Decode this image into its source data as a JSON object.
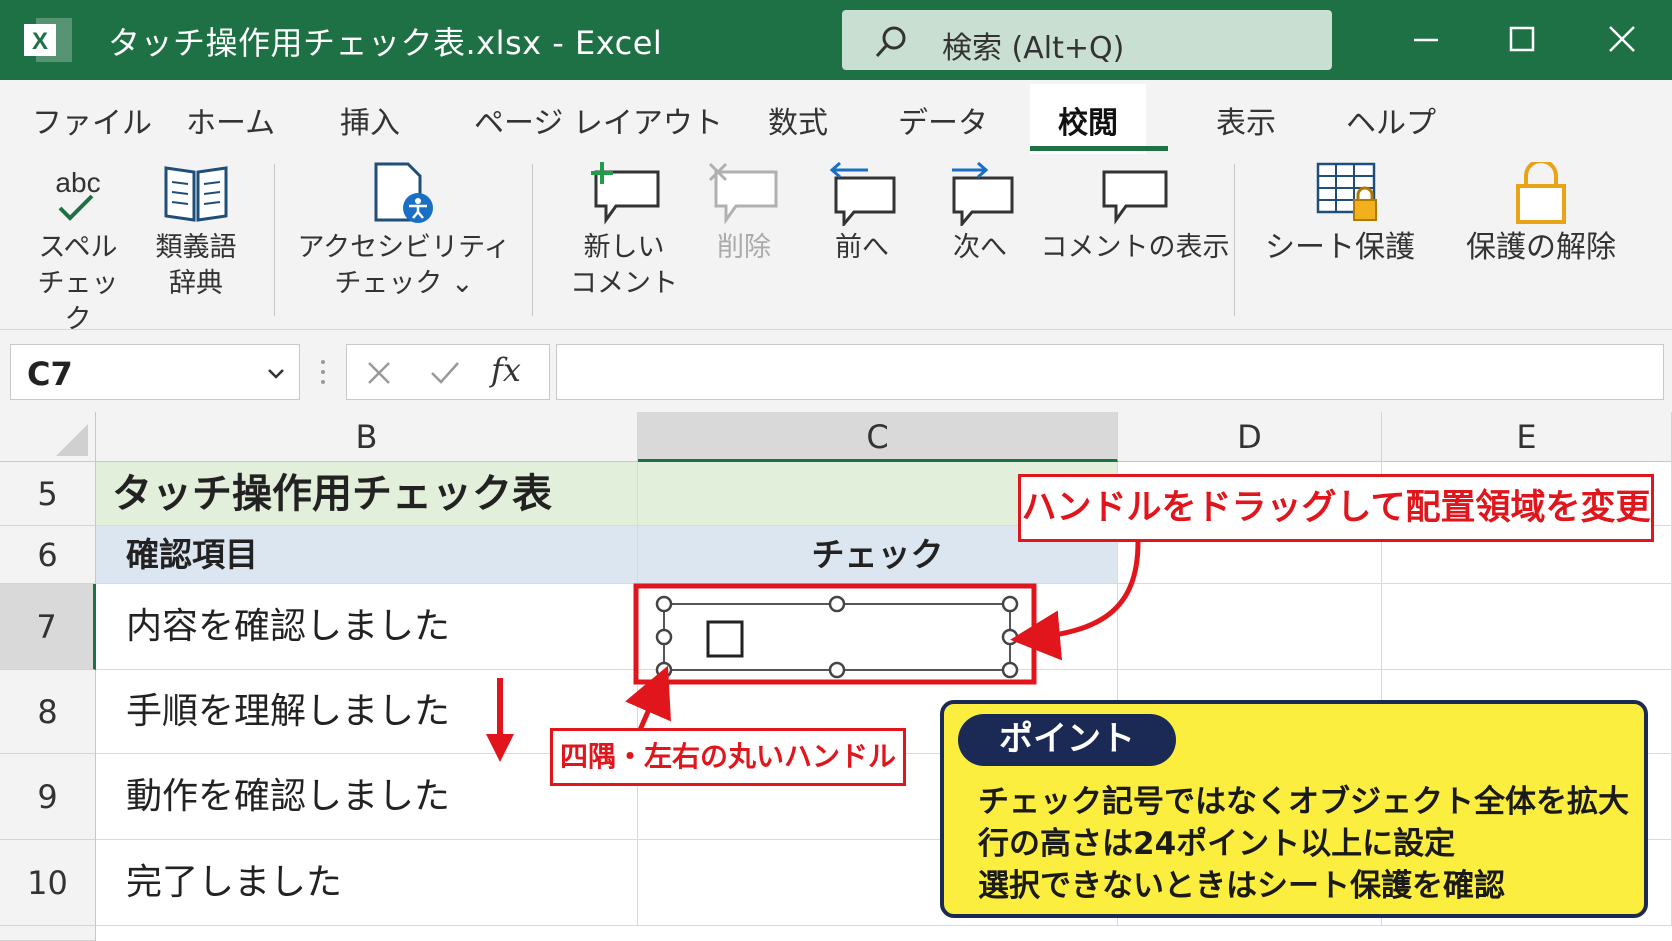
{
  "window": {
    "app_icon_letter": "X",
    "title": "タッチ操作用チェック表.xlsx  -  Excel",
    "search_placeholder": "検索 (Alt+Q)"
  },
  "ribbon_tabs": [
    "ファイル",
    "ホーム",
    "挿入",
    "ページ レイアウト",
    "数式",
    "データ",
    "校閲",
    "表示",
    "ヘルプ"
  ],
  "active_tab": "校閲",
  "ribbon_buttons": {
    "spelling": "スペル\nチェック",
    "thesaurus": "類義語\n辞典",
    "accessibility": "アクセシビリティ\nチェック ⌄",
    "new_comment": "新しい\nコメント",
    "delete": "削除",
    "previous": "前へ",
    "next": "次へ",
    "show_comments": "コメントの表示",
    "protect_sheet": "シート保護",
    "unprotect": "保護の解除"
  },
  "icon_text": {
    "abc": "abc"
  },
  "formula_bar": {
    "name_box": "C7",
    "fx": "fx",
    "formula": ""
  },
  "columns": [
    "B",
    "C",
    "D",
    "E"
  ],
  "selected_column": "C",
  "rows": [
    {
      "num": "5",
      "b": "タッチ操作用チェック表",
      "c": ""
    },
    {
      "num": "6",
      "b": "確認項目",
      "c": "チェック"
    },
    {
      "num": "7",
      "b": "内容を確認しました",
      "c": "☐"
    },
    {
      "num": "8",
      "b": "手順を理解しました",
      "c": ""
    },
    {
      "num": "9",
      "b": "動作を確認しました",
      "c": ""
    },
    {
      "num": "10",
      "b": "完了しました",
      "c": ""
    }
  ],
  "selected_row": "7",
  "annotations": {
    "handle_drag": "ハンドルをドラッグして配置領域を変更",
    "corner_handles": "四隅・左右の丸いハンドル",
    "point_title": "ポイント",
    "point_lines": [
      "チェック記号ではなくオブジェクト全体を拡大",
      "行の高さは24ポイント以上に設定",
      "選択できないときはシート保護を確認"
    ]
  },
  "colors": {
    "excel_green": "#1e7145",
    "annotation_red": "#e0161c",
    "point_yellow": "#fbee3f",
    "point_navy": "#1a2a55",
    "title_row_fill": "#e2efda",
    "header_row_fill": "#dce6f1"
  }
}
